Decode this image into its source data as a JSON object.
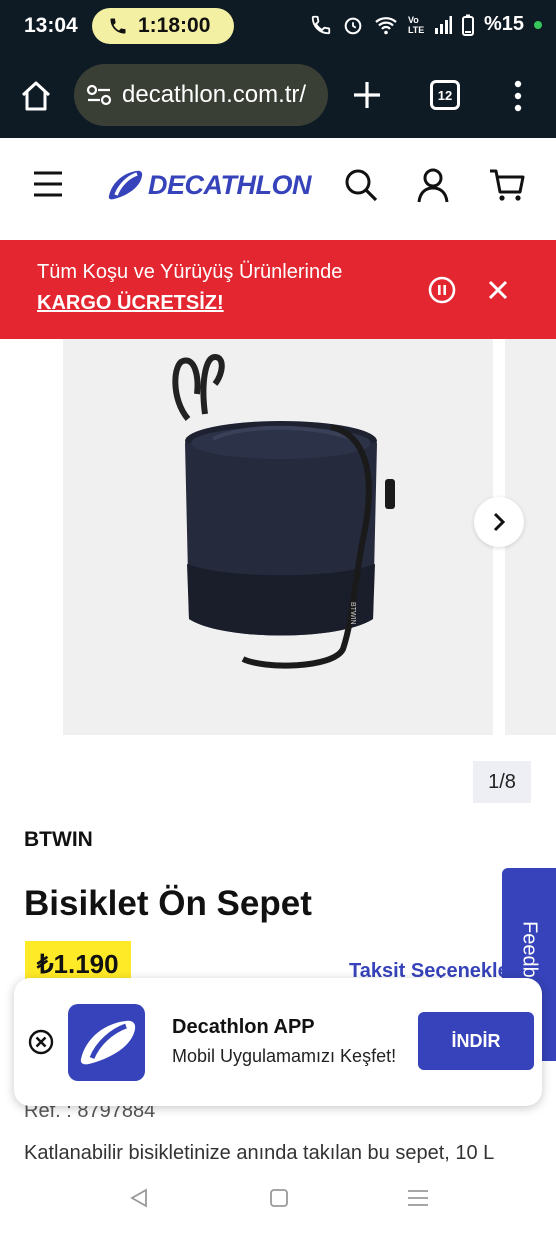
{
  "status_bar": {
    "time": "13:04",
    "call_duration": "1:18:00",
    "network_label": "Vo LTE",
    "battery": "%15",
    "icons": [
      "phone-call-icon",
      "wifi-calling-icon",
      "alarm-icon",
      "wifi-icon",
      "signal-icon",
      "battery-icon"
    ]
  },
  "browser": {
    "url": "decathlon.com.tr/",
    "tab_count": "12",
    "icons": [
      "home-icon",
      "site-settings-icon",
      "plus-icon",
      "tabs-icon",
      "more-vertical-icon"
    ]
  },
  "site_header": {
    "logo_text": "DECATHLON",
    "brand_color": "#3643ba",
    "icons": [
      "hamburger-menu-icon",
      "search-icon",
      "account-icon",
      "cart-icon"
    ]
  },
  "promo": {
    "line1": "Tüm Koşu ve Yürüyüş Ürünlerinde",
    "line2": "KARGO ÜCRETSİZ!",
    "color": "#e3262f"
  },
  "gallery": {
    "counter": "1/8",
    "product_image_text": "BTWIN"
  },
  "product": {
    "brand": "BTWIN",
    "title": "Bisiklet Ön Sepet",
    "price": "₺1.190",
    "installment_link": "Taksit Seçenekleri",
    "ref": "Ref. : 8797884",
    "description": "Katlanabilir bisikletinize anında takılan bu sepet, 10 L"
  },
  "feedback": {
    "label": "Feedback"
  },
  "app_banner": {
    "title": "Decathlon APP",
    "subtitle": "Mobil Uygulamamızı Keşfet!",
    "button": "İNDİR"
  }
}
